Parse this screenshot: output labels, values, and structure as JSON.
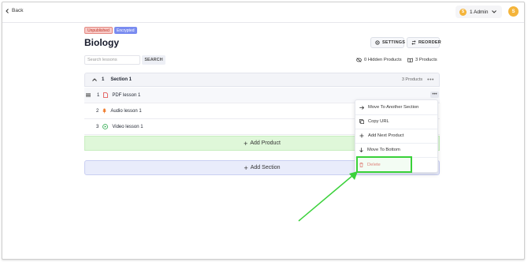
{
  "header": {
    "back_label": "Back",
    "admin_label": "1 Admin",
    "admin_initial": "S",
    "avatar_initial": "S"
  },
  "course": {
    "badges": [
      "Unpublished",
      "Encrypted"
    ],
    "title": "Biology",
    "settings_label": "SETTINGS",
    "reorder_label": "REORDER"
  },
  "search": {
    "placeholder": "Search lessons",
    "button_label": "SEARCH"
  },
  "meta": {
    "hidden_products": "0 Hidden Products",
    "products": "3 Products"
  },
  "section": {
    "number": "1",
    "title": "Section 1",
    "count": "3 Products",
    "lessons": [
      {
        "number": "1",
        "title": "PDF lesson 1",
        "icon": "pdf-icon"
      },
      {
        "number": "2",
        "title": "Audio lesson 1",
        "icon": "audio-icon"
      },
      {
        "number": "3",
        "title": "Video lesson 1",
        "icon": "video-icon"
      }
    ],
    "add_product_label": "Add Product"
  },
  "add_section_label": "Add Section",
  "menu": {
    "items": [
      {
        "label": "Move To Another Section",
        "icon": "arrow-right-icon"
      },
      {
        "label": "Copy URL",
        "icon": "copy-icon"
      },
      {
        "label": "Add Next Product",
        "icon": "plus-icon"
      },
      {
        "label": "Move To Bottom",
        "icon": "arrow-down-icon"
      },
      {
        "label": "Delete",
        "icon": "trash-icon"
      }
    ]
  },
  "colors": {
    "highlight": "#3ad13a",
    "delete": "#e04444",
    "add_product_bg": "#dff7d9",
    "add_section_bg": "#e9ecfb",
    "avatar": "#f4b43a"
  }
}
